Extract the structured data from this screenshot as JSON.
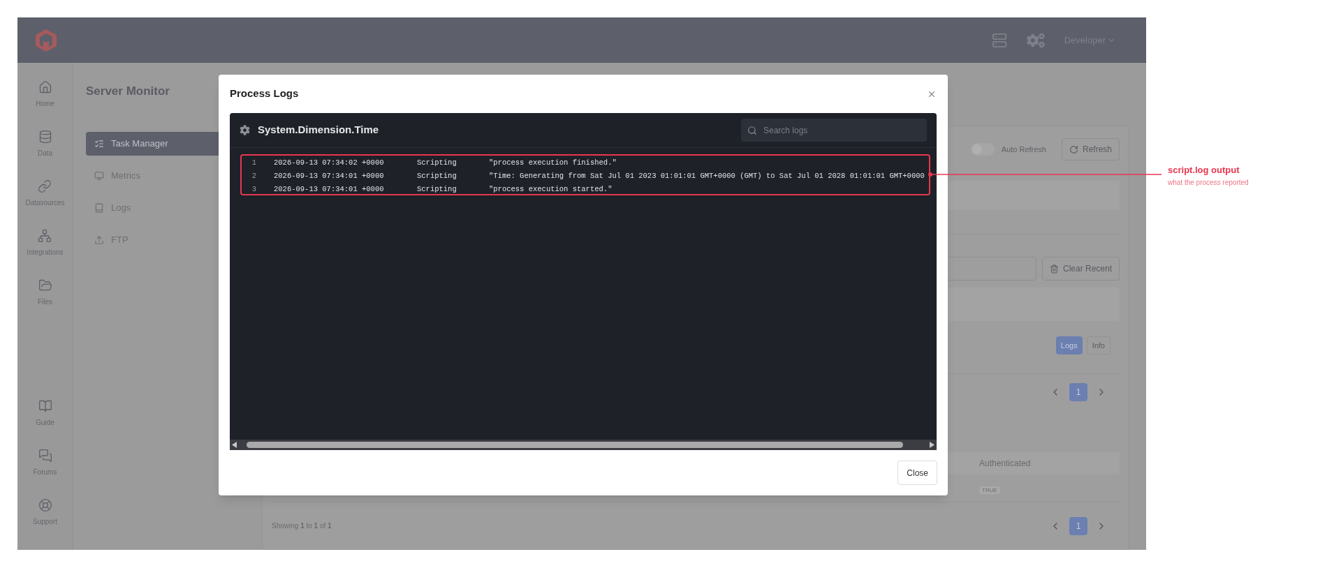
{
  "topbar": {
    "user_menu": "Developer"
  },
  "rail": {
    "items": [
      {
        "label": "Home"
      },
      {
        "label": "Data"
      },
      {
        "label": "Datasources"
      },
      {
        "label": "Integrations"
      },
      {
        "label": "Files"
      }
    ],
    "bottom_items": [
      {
        "label": "Guide"
      },
      {
        "label": "Forums"
      },
      {
        "label": "Support"
      }
    ]
  },
  "page": {
    "title": "Server Monitor",
    "nav": [
      {
        "label": "Task Manager",
        "selected": true
      },
      {
        "label": "Metrics",
        "selected": false
      },
      {
        "label": "Logs",
        "selected": false
      },
      {
        "label": "FTP",
        "selected": false
      }
    ]
  },
  "content": {
    "auto_refresh": {
      "label": "Auto Refresh",
      "on": false
    },
    "refresh_button": "Refresh",
    "clear_button": "Clear Recent",
    "view_tabs": [
      {
        "label": "Logs",
        "selected": true
      },
      {
        "label": "Info",
        "selected": false
      }
    ],
    "pagination_top": [
      {
        "label": "1",
        "selected": true
      }
    ],
    "table": {
      "columns": [
        "Authenticated"
      ],
      "rows": [
        [
          "TRUE"
        ]
      ]
    },
    "footer": "Showing **1** to **1** of **1**",
    "pagination_bottom": [
      {
        "label": "1",
        "selected": true
      }
    ]
  },
  "modal": {
    "title": "Process Logs",
    "panel_title": "System.Dimension.Time",
    "search": {
      "placeholder": "Search logs"
    },
    "lines": [
      {
        "number": "1",
        "time": "2026-09-13 07:34:02 +0000",
        "source": "Scripting",
        "message": "\"process execution finished.\""
      },
      {
        "number": "2",
        "time": "2026-09-13 07:34:01 +0000",
        "source": "Scripting",
        "message": "\"Time: Generating from Sat Jul 01 2023 01:01:01 GMT+0000 (GMT) to Sat Jul 01 2028 01:01:01 GMT+0000"
      },
      {
        "number": "3",
        "time": "2026-09-13 07:34:01 +0000",
        "source": "Scripting",
        "message": "\"process execution started.\""
      }
    ],
    "close_button": "Close"
  },
  "annotation": {
    "title": "script.log output",
    "subtitle": "what the process reported"
  }
}
